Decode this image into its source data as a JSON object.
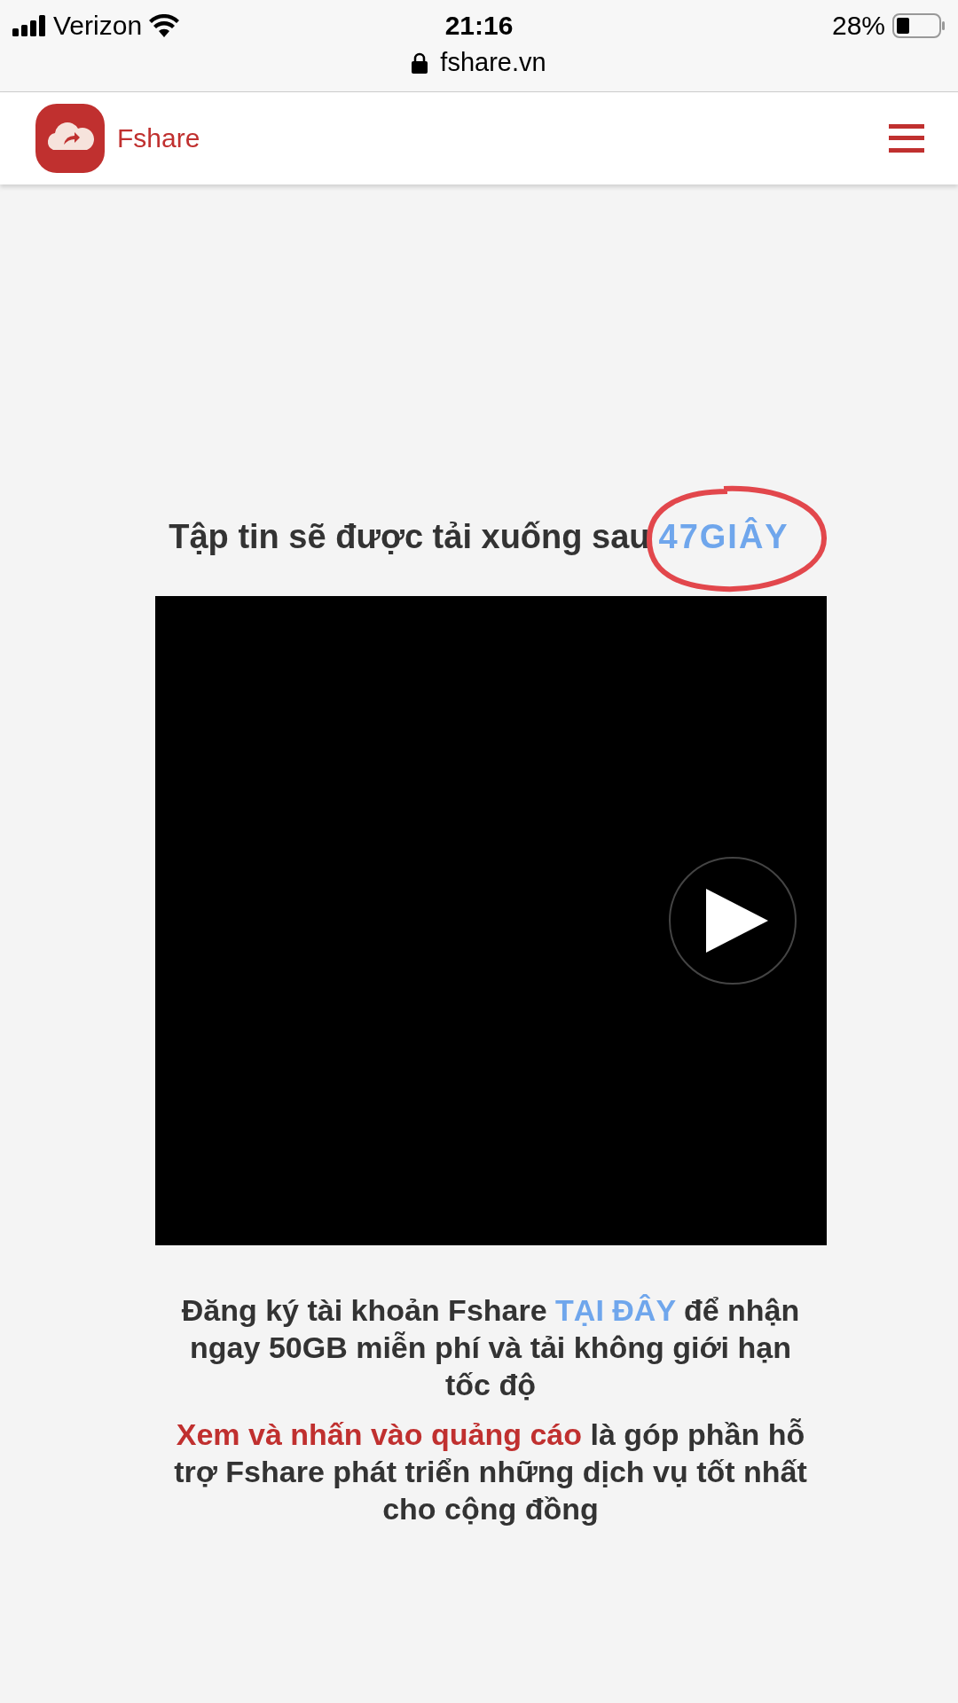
{
  "status_bar": {
    "carrier": "Verizon",
    "time": "21:16",
    "battery": "28%"
  },
  "address_bar": {
    "url": "fshare.vn"
  },
  "header": {
    "brand": "Fshare"
  },
  "countdown": {
    "label": "Tập tin sẽ được tải xuống sau",
    "value": "47GIÂY",
    "circled": true
  },
  "paragraphs": [
    {
      "parts": [
        {
          "kind": "text",
          "text": "Đăng ký tài khoản Fshare "
        },
        {
          "kind": "link",
          "text": "TẠI ĐÂY"
        },
        {
          "kind": "text",
          "text": " để nhận ngay 50GB miễn phí và tải không giới hạn tốc độ"
        }
      ]
    },
    {
      "parts": [
        {
          "kind": "highlight",
          "text": "Xem và nhấn vào quảng cáo"
        },
        {
          "kind": "text",
          "text": " là góp phần hỗ trợ Fshare phát triển những dịch vụ tốt nhất cho cộng đồng"
        }
      ]
    }
  ]
}
